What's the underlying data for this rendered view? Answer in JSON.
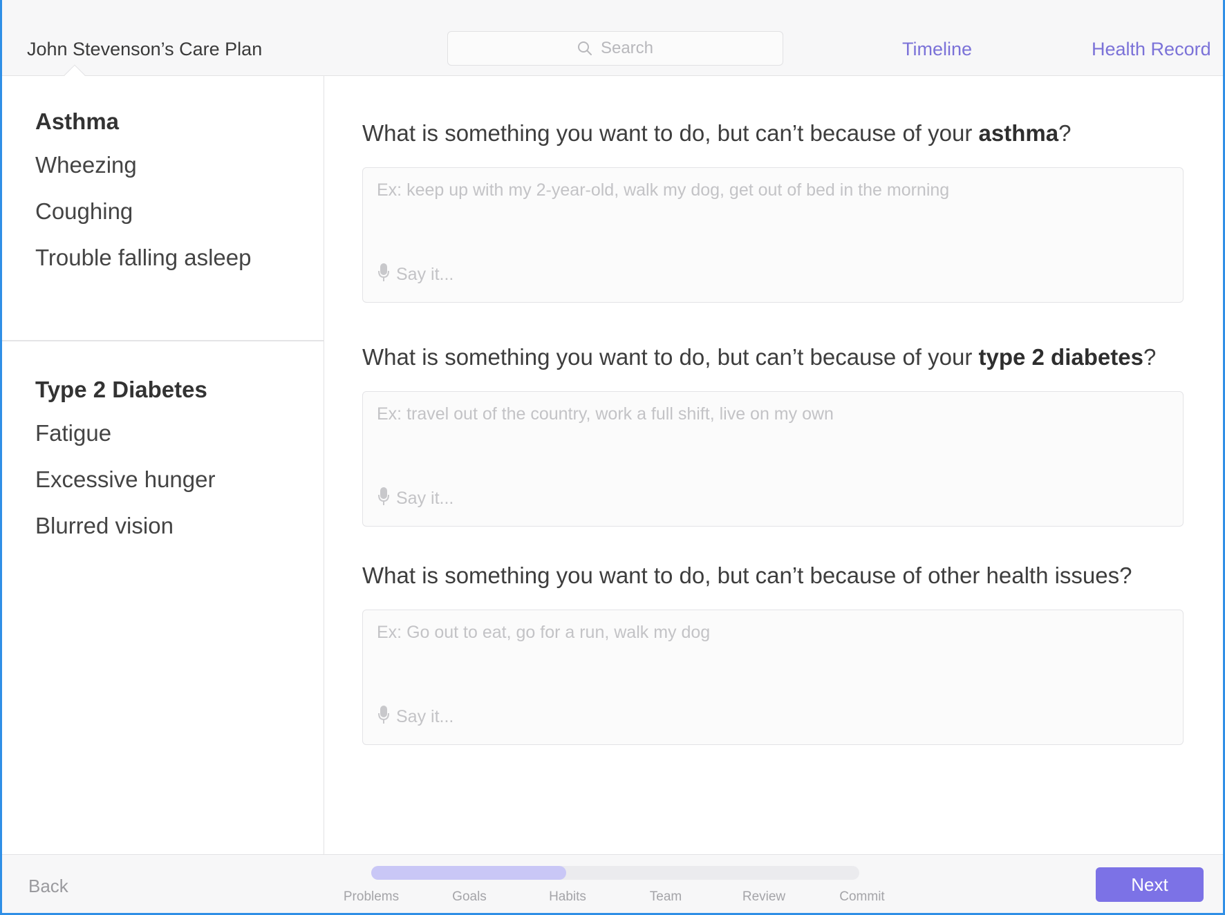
{
  "header": {
    "care_plan_title": "John Stevenson’s Care Plan",
    "search_placeholder": "Search",
    "nav": {
      "timeline": "Timeline",
      "health_record": "Health Record"
    }
  },
  "sidebar": {
    "groups": [
      {
        "title": "Asthma",
        "items": [
          "Wheezing",
          "Coughing",
          "Trouble falling asleep"
        ]
      },
      {
        "title": "Type 2 Diabetes",
        "items": [
          "Fatigue",
          "Excessive hunger",
          "Blurred vision"
        ]
      }
    ]
  },
  "main": {
    "questions": [
      {
        "prefix": "What is something you want to do, but can’t because of your ",
        "emphasis": "asthma",
        "suffix": "?",
        "placeholder": "Ex: keep up with my 2-year-old, walk my dog, get out of bed in the morning",
        "voice_label": "Say it..."
      },
      {
        "prefix": "What is something you want to do, but can’t because of your ",
        "emphasis": "type 2 diabetes",
        "suffix": "?",
        "placeholder": "Ex: travel out of the country, work a full shift, live on my own",
        "voice_label": "Say it..."
      },
      {
        "prefix": "What is something you want to do, but can’t because of other health issues?",
        "emphasis": "",
        "suffix": "",
        "placeholder": "Ex: Go out to eat, go for a run, walk my dog",
        "voice_label": "Say it..."
      }
    ]
  },
  "footer": {
    "back_label": "Back",
    "next_label": "Next",
    "progress_fraction": 0.4,
    "steps": [
      "Problems",
      "Goals",
      "Habits",
      "Team",
      "Review",
      "Commit"
    ]
  },
  "colors": {
    "accent": "#7c72e6",
    "link": "#7b72d8",
    "progress_fill": "#c9c7f6",
    "frame_border": "#2f8fe6"
  },
  "icons": {
    "search": "search-icon",
    "microphone": "microphone-icon"
  }
}
